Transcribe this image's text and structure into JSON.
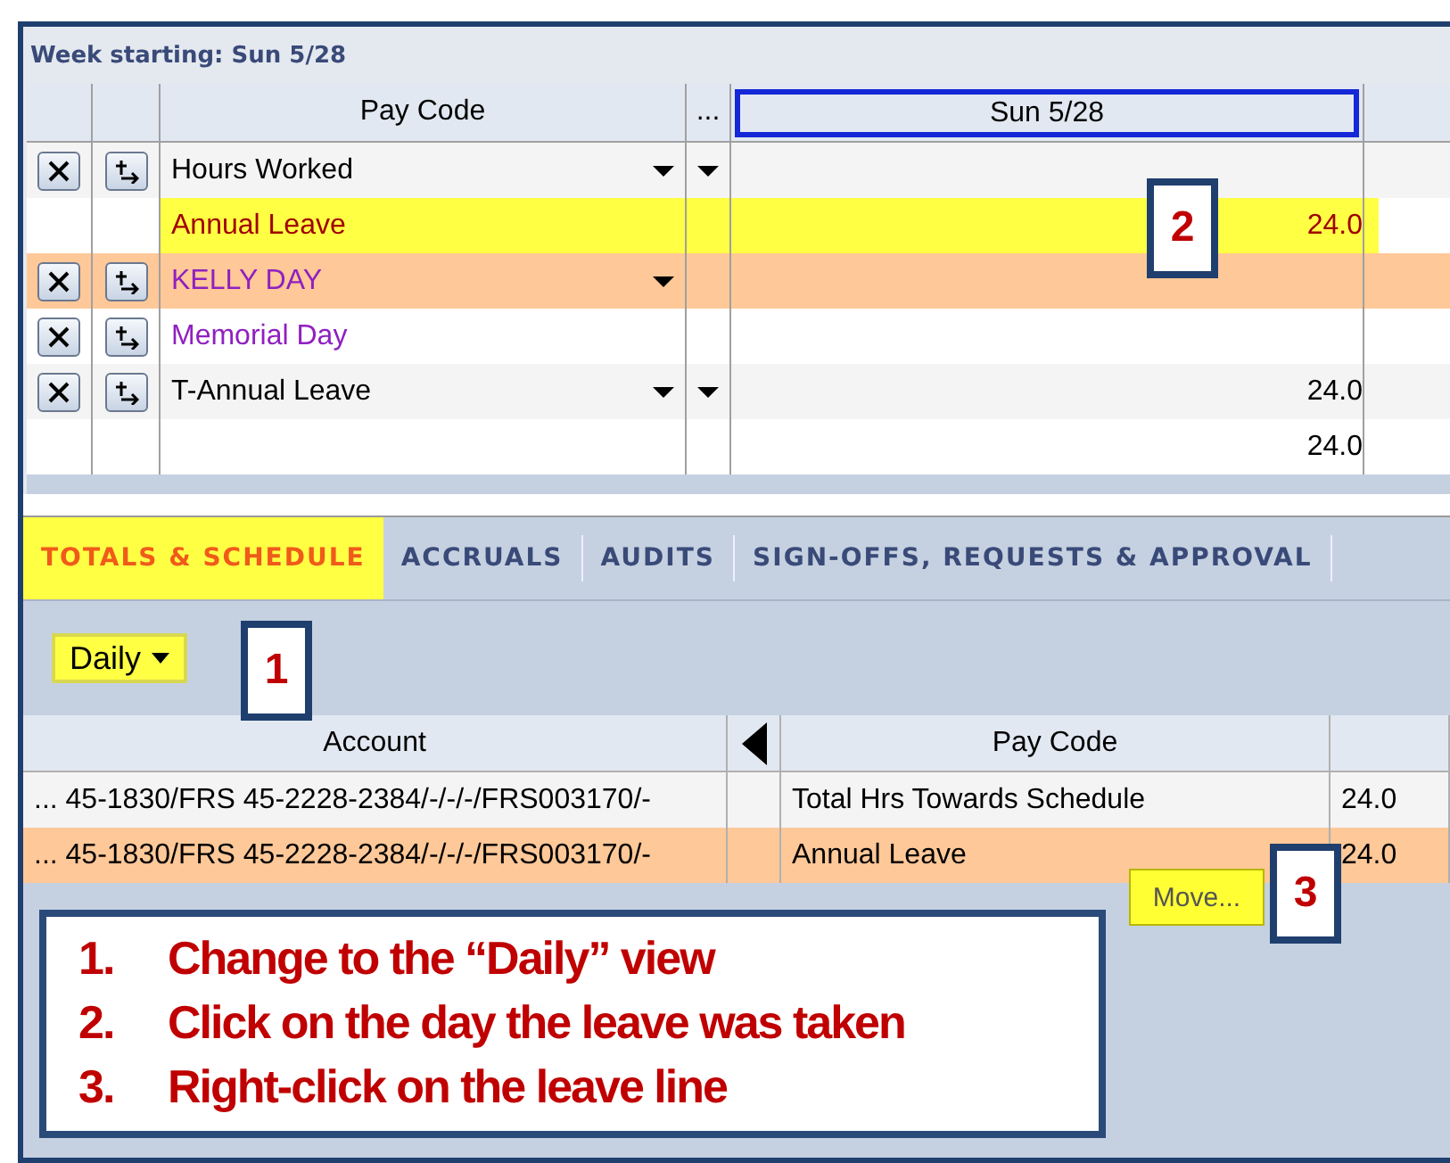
{
  "week_panel": {
    "title": "Week starting: Sun 5/28",
    "columns": {
      "pay_code": "Pay Code",
      "extra": "...",
      "day": "Sun 5/28"
    },
    "rows": [
      {
        "pay_code": "Hours Worked",
        "color": "#000000",
        "has_actions": true,
        "has_dropdown": true,
        "has_extra_dropdown": true,
        "highlighted": false,
        "selected": false,
        "value": ""
      },
      {
        "pay_code": "Annual Leave",
        "color": "#a00000",
        "has_actions": false,
        "has_dropdown": false,
        "has_extra_dropdown": false,
        "highlighted": true,
        "selected": false,
        "value": "24.0"
      },
      {
        "pay_code": "KELLY DAY",
        "color": "#9020c0",
        "has_actions": true,
        "has_dropdown": true,
        "has_extra_dropdown": false,
        "highlighted": false,
        "selected": true,
        "value": ""
      },
      {
        "pay_code": "Memorial Day",
        "color": "#9020c0",
        "has_actions": true,
        "has_dropdown": false,
        "has_extra_dropdown": false,
        "highlighted": false,
        "selected": false,
        "value": ""
      },
      {
        "pay_code": "T-Annual Leave",
        "color": "#000000",
        "has_actions": true,
        "has_dropdown": true,
        "has_extra_dropdown": true,
        "highlighted": false,
        "selected": false,
        "value": "24.0"
      },
      {
        "pay_code": "",
        "has_actions": false,
        "has_dropdown": false,
        "has_extra_dropdown": false,
        "highlighted": false,
        "selected": false,
        "value": "24.0"
      }
    ]
  },
  "tabs": [
    {
      "label": "TOTALS & SCHEDULE",
      "selected": true
    },
    {
      "label": "ACCRUALS",
      "selected": false
    },
    {
      "label": "AUDITS",
      "selected": false
    },
    {
      "label": "SIGN-OFFS, REQUESTS & APPROVAL",
      "selected": false
    }
  ],
  "view_select": {
    "value": "Daily"
  },
  "totals": {
    "columns": {
      "account": "Account",
      "pay_code": "Pay Code"
    },
    "rows": [
      {
        "account": "... 45-1830/FRS 45-2228-2384/-/-/-/FRS003170/-",
        "pay_code": "Total Hrs Towards Schedule",
        "value": "24.0",
        "selected": false
      },
      {
        "account": "... 45-1830/FRS 45-2228-2384/-/-/-/FRS003170/-",
        "pay_code": "Annual Leave",
        "value": "24.0",
        "selected": true
      }
    ]
  },
  "context_menu": {
    "item": "Move..."
  },
  "callouts": [
    "2",
    "1",
    "3"
  ],
  "instructions": [
    {
      "number": "1.",
      "text": "Change to the “Daily” view"
    },
    {
      "number": "2.",
      "text": "Click on the day the leave was taken"
    },
    {
      "number": "3.",
      "text": "Right-click on the leave line"
    }
  ]
}
